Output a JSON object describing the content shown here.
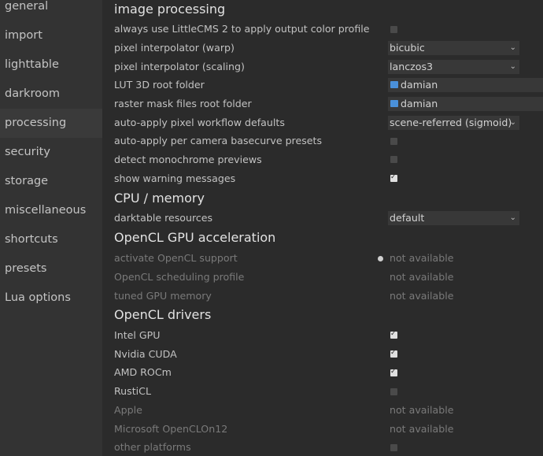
{
  "sidebar": {
    "items": [
      {
        "label": "general"
      },
      {
        "label": "import"
      },
      {
        "label": "lighttable"
      },
      {
        "label": "darkroom"
      },
      {
        "label": "processing",
        "active": true
      },
      {
        "label": "security"
      },
      {
        "label": "storage"
      },
      {
        "label": "miscellaneous"
      },
      {
        "label": "shortcuts"
      },
      {
        "label": "presets"
      },
      {
        "label": "Lua options"
      }
    ]
  },
  "sections": {
    "image_processing": {
      "title": "image processing",
      "lcms_label": "always use LittleCMS 2 to apply output color profile",
      "lcms_checked": false,
      "warp_label": "pixel interpolator (warp)",
      "warp_value": "bicubic",
      "scaling_label": "pixel interpolator (scaling)",
      "scaling_value": "lanczos3",
      "lut_label": "LUT 3D root folder",
      "lut_value": "damian",
      "mask_label": "raster mask files root folder",
      "mask_value": "damian",
      "workflow_label": "auto-apply pixel workflow defaults",
      "workflow_value": "scene-referred (sigmoid)",
      "basecurve_label": "auto-apply per camera basecurve presets",
      "basecurve_checked": false,
      "mono_label": "detect monochrome previews",
      "mono_checked": false,
      "warn_label": "show warning messages",
      "warn_checked": true
    },
    "cpu": {
      "title": "CPU / memory",
      "resources_label": "darktable resources",
      "resources_value": "default"
    },
    "opencl": {
      "title": "OpenCL GPU acceleration",
      "activate_label": "activate OpenCL support",
      "activate_value": "not available",
      "scheduling_label": "OpenCL scheduling profile",
      "scheduling_value": "not available",
      "tuned_label": "tuned GPU memory",
      "tuned_value": "not available"
    },
    "drivers": {
      "title": "OpenCL drivers",
      "intel_label": "Intel GPU",
      "intel_checked": true,
      "nvidia_label": "Nvidia CUDA",
      "nvidia_checked": true,
      "amd_label": "AMD ROCm",
      "amd_checked": true,
      "rusticl_label": "RustiCL",
      "rusticl_checked": false,
      "apple_label": "Apple",
      "apple_value": "not available",
      "ms_label": "Microsoft OpenCLOn12",
      "ms_value": "not available",
      "other_label": "other platforms"
    }
  },
  "icons": {
    "dropdown": "chevron-down-icon",
    "folder": "folder-icon",
    "checkbox": "checkmark-icon",
    "status": "status-dot-icon"
  },
  "colors": {
    "folder_icon": "#4a90d9",
    "main_bg": "#2b2b2b",
    "sidebar_bg": "#333333"
  }
}
